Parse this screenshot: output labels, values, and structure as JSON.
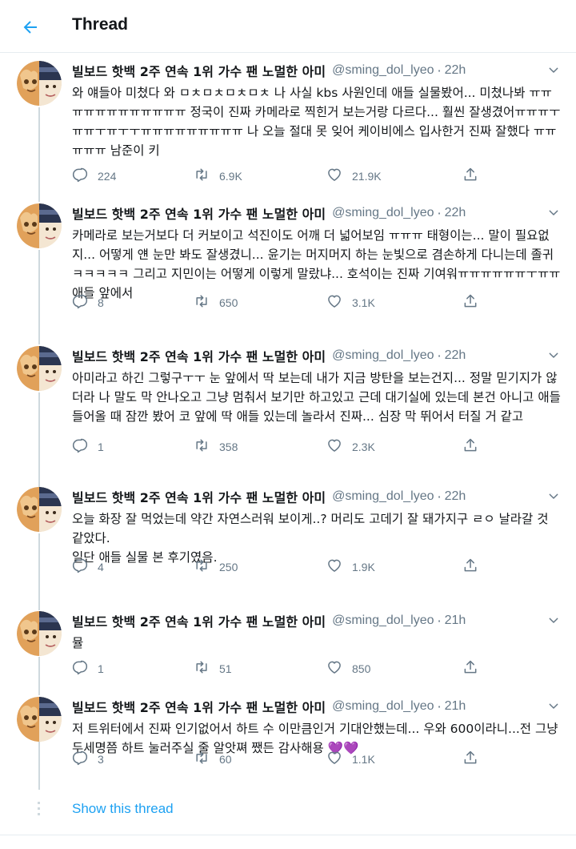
{
  "header": {
    "title": "Thread",
    "back_icon": "arrow-left-icon"
  },
  "colors": {
    "accent": "#1da1f2",
    "secondary_text": "#657786",
    "primary_text": "#14171a",
    "thread_line": "#cfd9de",
    "emoji_heart": "#a37fd6"
  },
  "tweets": [
    {
      "name": "빌보드 핫백 2주 연속 1위 가수 팬 노멀한 아미",
      "handle": "@sming_dol_lyeo",
      "sep": "·",
      "time": "22h",
      "text": "와 얘들아 미쳤다 와 ㅁㅊㅁㅊㅁㅊㅁㅊ 나 사실 kbs 사원인데 애들 실물봤어... 미쳤나봐 ㅠㅠㅠㅠㅠㅠㅠㅠㅠㅠㅠㅠ 정국이 진짜 카메라로 찍힌거 보는거랑 다르다... 훨씬 잘생겼어ㅠㅠㅠㅜㅠㅠㅜㅠㅜㅜㅠㅠㅠㅠㅠㅠㅠㅠㅠ 나 오늘 절대 못 잊어 케이비에스 입사한거 진짜 잘했다 ㅠㅠㅠㅠㅠ 남준이 키",
      "replies": "224",
      "retweets": "6.9K",
      "likes": "21.9K"
    },
    {
      "name": "빌보드 핫백 2주 연속 1위 가수 팬 노멀한 아미",
      "handle": "@sming_dol_lyeo",
      "sep": "·",
      "time": "22h",
      "text": "카메라로 보는거보다 더 커보이고 석진이도 어깨 더 넓어보임 ㅠㅠㅠ 태형이는... 말이 필요없지... 어떻게 얜 눈만 봐도 잘생겼니... 윤기는 머지머지 하는 눈빛으로 겸손하게 다니는데 졸귀 ㅋㅋㅋㅋㅋ 그리고 지민이는 어떻게 이렇게 말랐냐... 호석이는 진짜 기여워ㅠㅠㅠㅠㅠㅠㅜㅠㅠ 애들 앞에서",
      "replies": "8",
      "retweets": "650",
      "likes": "3.1K"
    },
    {
      "name": "빌보드 핫백 2주 연속 1위 가수 팬 노멀한 아미",
      "handle": "@sming_dol_lyeo",
      "sep": "·",
      "time": "22h",
      "text": "아미라고 하긴 그렇구ㅜㅜ 눈 앞에서 딱 보는데 내가 지금 방탄을 보는건지... 정말 믿기지가 않더라 나 말도 막 안나오고 그냥 멈춰서 보기만 하고있고 근데 대기실에 있는데 본건 아니고 애들 들어올 때 잠깐 봤어 코 앞에 딱 애들 있는데 놀라서 진짜... 심장 막 뛰어서 터질 거 같고",
      "replies": "1",
      "retweets": "358",
      "likes": "2.3K"
    },
    {
      "name": "빌보드 핫백 2주 연속 1위 가수 팬 노멀한 아미",
      "handle": "@sming_dol_lyeo",
      "sep": "·",
      "time": "22h",
      "text": "오늘 화장 잘 먹었는데 약간 자연스러워 보이게..? 머리도 고데기 잘 돼가지구 ㄹㅇ 날라갈 것 같았다.\n일단 애들 실물 본 후기였음.",
      "replies": "4",
      "retweets": "250",
      "likes": "1.9K"
    },
    {
      "name": "빌보드 핫백 2주 연속 1위 가수 팬 노멀한 아미",
      "handle": "@sming_dol_lyeo",
      "sep": "·",
      "time": "21h",
      "text": "뮬",
      "replies": "1",
      "retweets": "51",
      "likes": "850"
    },
    {
      "name": "빌보드 핫백 2주 연속 1위 가수 팬 노멀한 아미",
      "handle": "@sming_dol_lyeo",
      "sep": "·",
      "time": "21h",
      "text": "저 트위터에서 진짜 인기없어서 하트 수 이만큼인거 기대안했는데... 우와 600이라니...전 그냥 두세명쯤 하트 눌러주실 줄 알앗쪄 쨌든 감사해용 💜💜",
      "replies": "3",
      "retweets": "60",
      "likes": "1.1K"
    }
  ],
  "icons": {
    "reply": "reply-icon",
    "retweet": "retweet-icon",
    "like": "like-icon",
    "share": "share-icon",
    "more": "chevron-down-icon"
  },
  "footer": {
    "show_thread": "Show this thread"
  }
}
